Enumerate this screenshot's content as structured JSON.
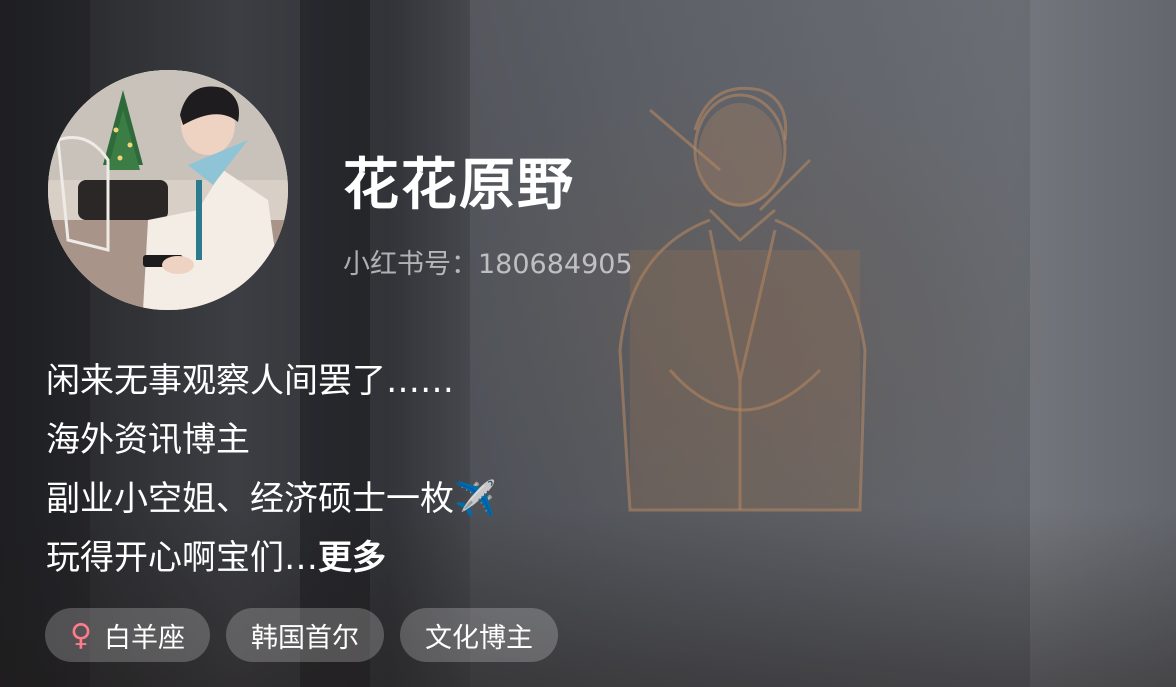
{
  "profile": {
    "nickname": "花花原野",
    "red_id": "小红书号：180684905",
    "bio_lines": [
      "闲来无事观察人间罢了……",
      "海外资讯博主",
      "副业小空姐、经济硕士一枚✈️",
      "玩得开心啊宝们…"
    ],
    "more_label": "更多",
    "tags": {
      "gender_symbol": "♀",
      "zodiac": "白羊座",
      "location": "韩国首尔",
      "category": "文化博主"
    }
  },
  "colors": {
    "gender_female": "#ff7a8a",
    "text": "#ffffff"
  }
}
